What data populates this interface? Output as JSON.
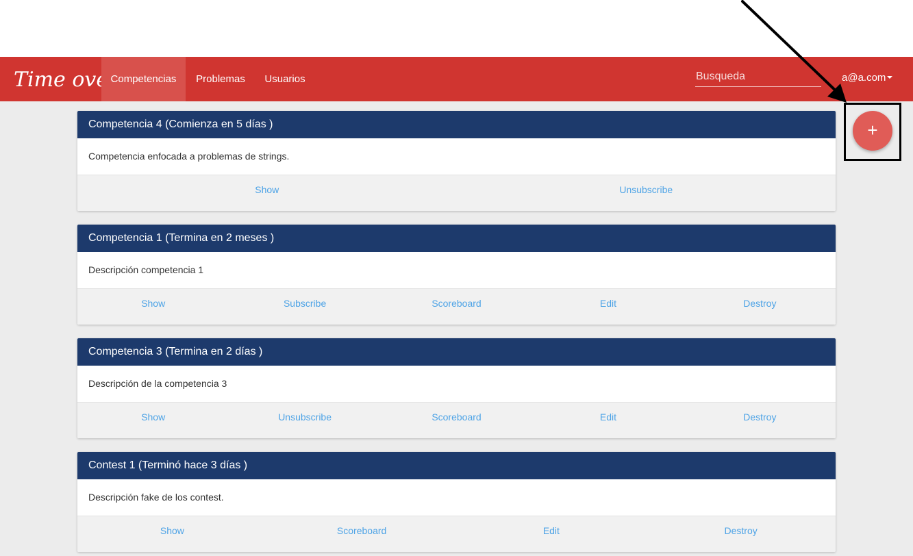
{
  "nav": {
    "brand": "Time over",
    "items": [
      {
        "label": "Competencias",
        "active": true
      },
      {
        "label": "Problemas",
        "active": false
      },
      {
        "label": "Usuarios",
        "active": false
      }
    ],
    "search_placeholder": "Busqueda",
    "user": "a@a.com"
  },
  "fab": {
    "label": "+"
  },
  "cards": [
    {
      "title": "Competencia 4 (Comienza en 5 días )",
      "description": "Competencia enfocada a problemas de strings.",
      "actions": [
        "Show",
        "Unsubscribe"
      ]
    },
    {
      "title": "Competencia 1 (Termina en 2 meses )",
      "description": "Descripción competencia 1",
      "actions": [
        "Show",
        "Subscribe",
        "Scoreboard",
        "Edit",
        "Destroy"
      ]
    },
    {
      "title": "Competencia 3 (Termina en 2 días )",
      "description": "Descripción de la competencia 3",
      "actions": [
        "Show",
        "Unsubscribe",
        "Scoreboard",
        "Edit",
        "Destroy"
      ]
    },
    {
      "title": "Contest 1 (Terminó hace 3 días )",
      "description": "Descripción fake de los contest.",
      "actions": [
        "Show",
        "Scoreboard",
        "Edit",
        "Destroy"
      ]
    }
  ],
  "colors": {
    "navbar": "#d03530",
    "nav_active": "#d8514c",
    "card_header": "#1d3a6c",
    "link": "#4da3e6",
    "fab": "#e05c57",
    "page_background": "#ececec"
  }
}
